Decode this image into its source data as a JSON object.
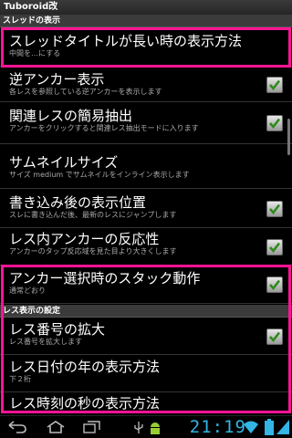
{
  "app": {
    "title": "Tuboroid改"
  },
  "sections": {
    "thread_display": "スレッドの表示",
    "res_display": "レス表示の設定"
  },
  "items": [
    {
      "title": "スレッドタイトルが長い時の表示方法",
      "summary": "中間を…にする",
      "checked": null
    },
    {
      "title": "逆アンカー表示",
      "summary": "各レスを参照している逆アンカーを表示します",
      "checked": true
    },
    {
      "title": "関連レスの簡易抽出",
      "summary": "アンカーをクリックすると関連レス抽出モードに入ります",
      "checked": true
    },
    {
      "title": "サムネイルサイズ",
      "summary": "サイズ medium でサムネイルをインライン表示します",
      "checked": null
    },
    {
      "title": "書き込み後の表示位置",
      "summary": "スレに書き込んだ後、最新のレスにジャンプします",
      "checked": true
    },
    {
      "title": "レス内アンカーの反応性",
      "summary": "アンカーのタップ反応域を見た目より大きくします",
      "checked": true
    },
    {
      "title": "アンカー選択時のスタック動作",
      "summary": "通常どおり",
      "checked": true
    },
    {
      "title": "レス番号の拡大",
      "summary": "レス番号を拡大します",
      "checked": true
    },
    {
      "title": "レス日付の年の表示方法",
      "summary": "下２桁",
      "checked": null
    },
    {
      "title": "レス時刻の秒の表示方法",
      "summary": "",
      "checked": null
    }
  ],
  "statusbar": {
    "clock": "21:19"
  },
  "colors": {
    "accent": "#33b5e5",
    "highlight": "#ff1493"
  }
}
